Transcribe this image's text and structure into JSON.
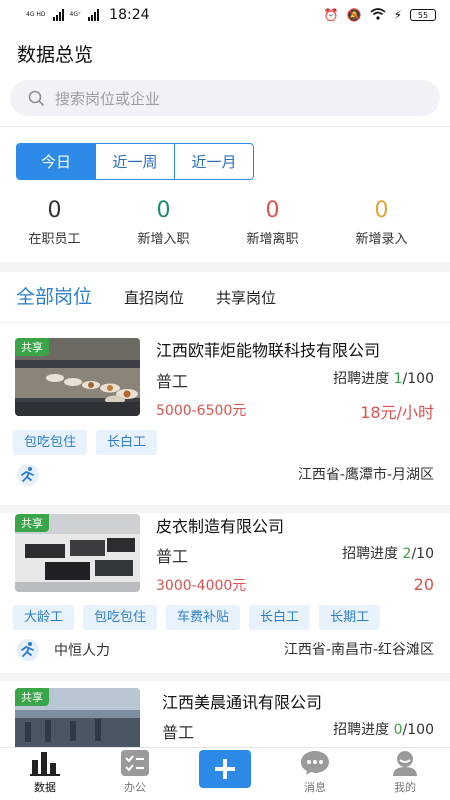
{
  "status_bar": {
    "net1": "4G HD",
    "net2": "4G⁺",
    "time": "18:24",
    "battery": "55"
  },
  "page_title": "数据总览",
  "search": {
    "placeholder": "搜索岗位或企业"
  },
  "period_tabs": [
    {
      "label": "今日",
      "active": true
    },
    {
      "label": "近一周",
      "active": false
    },
    {
      "label": "近一月",
      "active": false
    }
  ],
  "stats": [
    {
      "value": "0",
      "label": "在职员工",
      "color": "#333333"
    },
    {
      "value": "0",
      "label": "新增入职",
      "color": "#1f8a6c"
    },
    {
      "value": "0",
      "label": "新增离职",
      "color": "#d9534f"
    },
    {
      "value": "0",
      "label": "新增录入",
      "color": "#e0a33a"
    }
  ],
  "job_tabs": [
    {
      "label": "全部岗位",
      "active": true
    },
    {
      "label": "直招岗位",
      "active": false
    },
    {
      "label": "共享岗位",
      "active": false
    }
  ],
  "jobs": [
    {
      "share_tag": "共享",
      "company": "江西欧菲炬能物联科技有限公司",
      "job_title": "普工",
      "progress_label": "招聘进度",
      "progress_current": "1",
      "progress_total": "/100",
      "salary": "5000-6500元",
      "rate": "18元/小时",
      "tags": [
        "包吃包住",
        "长白工"
      ],
      "agency": "",
      "location": "江西省-鹰潭市-月湖区"
    },
    {
      "share_tag": "共享",
      "company": "皮衣制造有限公司",
      "job_title": "普工",
      "progress_label": "招聘进度",
      "progress_current": "2",
      "progress_total": "/10",
      "salary": "3000-4000元",
      "rate": "20",
      "tags": [
        "大龄工",
        "包吃包住",
        "车费补贴",
        "长白工",
        "长期工"
      ],
      "agency": "中恒人力",
      "location": "江西省-南昌市-红谷滩区"
    },
    {
      "share_tag": "共享",
      "company": "江西美晨通讯有限公司",
      "job_title": "普工",
      "progress_label": "招聘进度",
      "progress_current": "0",
      "progress_total": "/100"
    }
  ],
  "bottom_nav": [
    {
      "label": "数据",
      "icon": "bar-chart-icon",
      "active": true
    },
    {
      "label": "办公",
      "icon": "checklist-icon",
      "active": false
    },
    {
      "label": "",
      "icon": "plus-icon",
      "active": false
    },
    {
      "label": "消息",
      "icon": "chat-bubble-icon",
      "active": false
    },
    {
      "label": "我的",
      "icon": "user-icon",
      "active": false
    }
  ],
  "colors": {
    "accent": "#2d8ae6",
    "share_green": "#3aa548",
    "salary_red": "#d9534f"
  }
}
